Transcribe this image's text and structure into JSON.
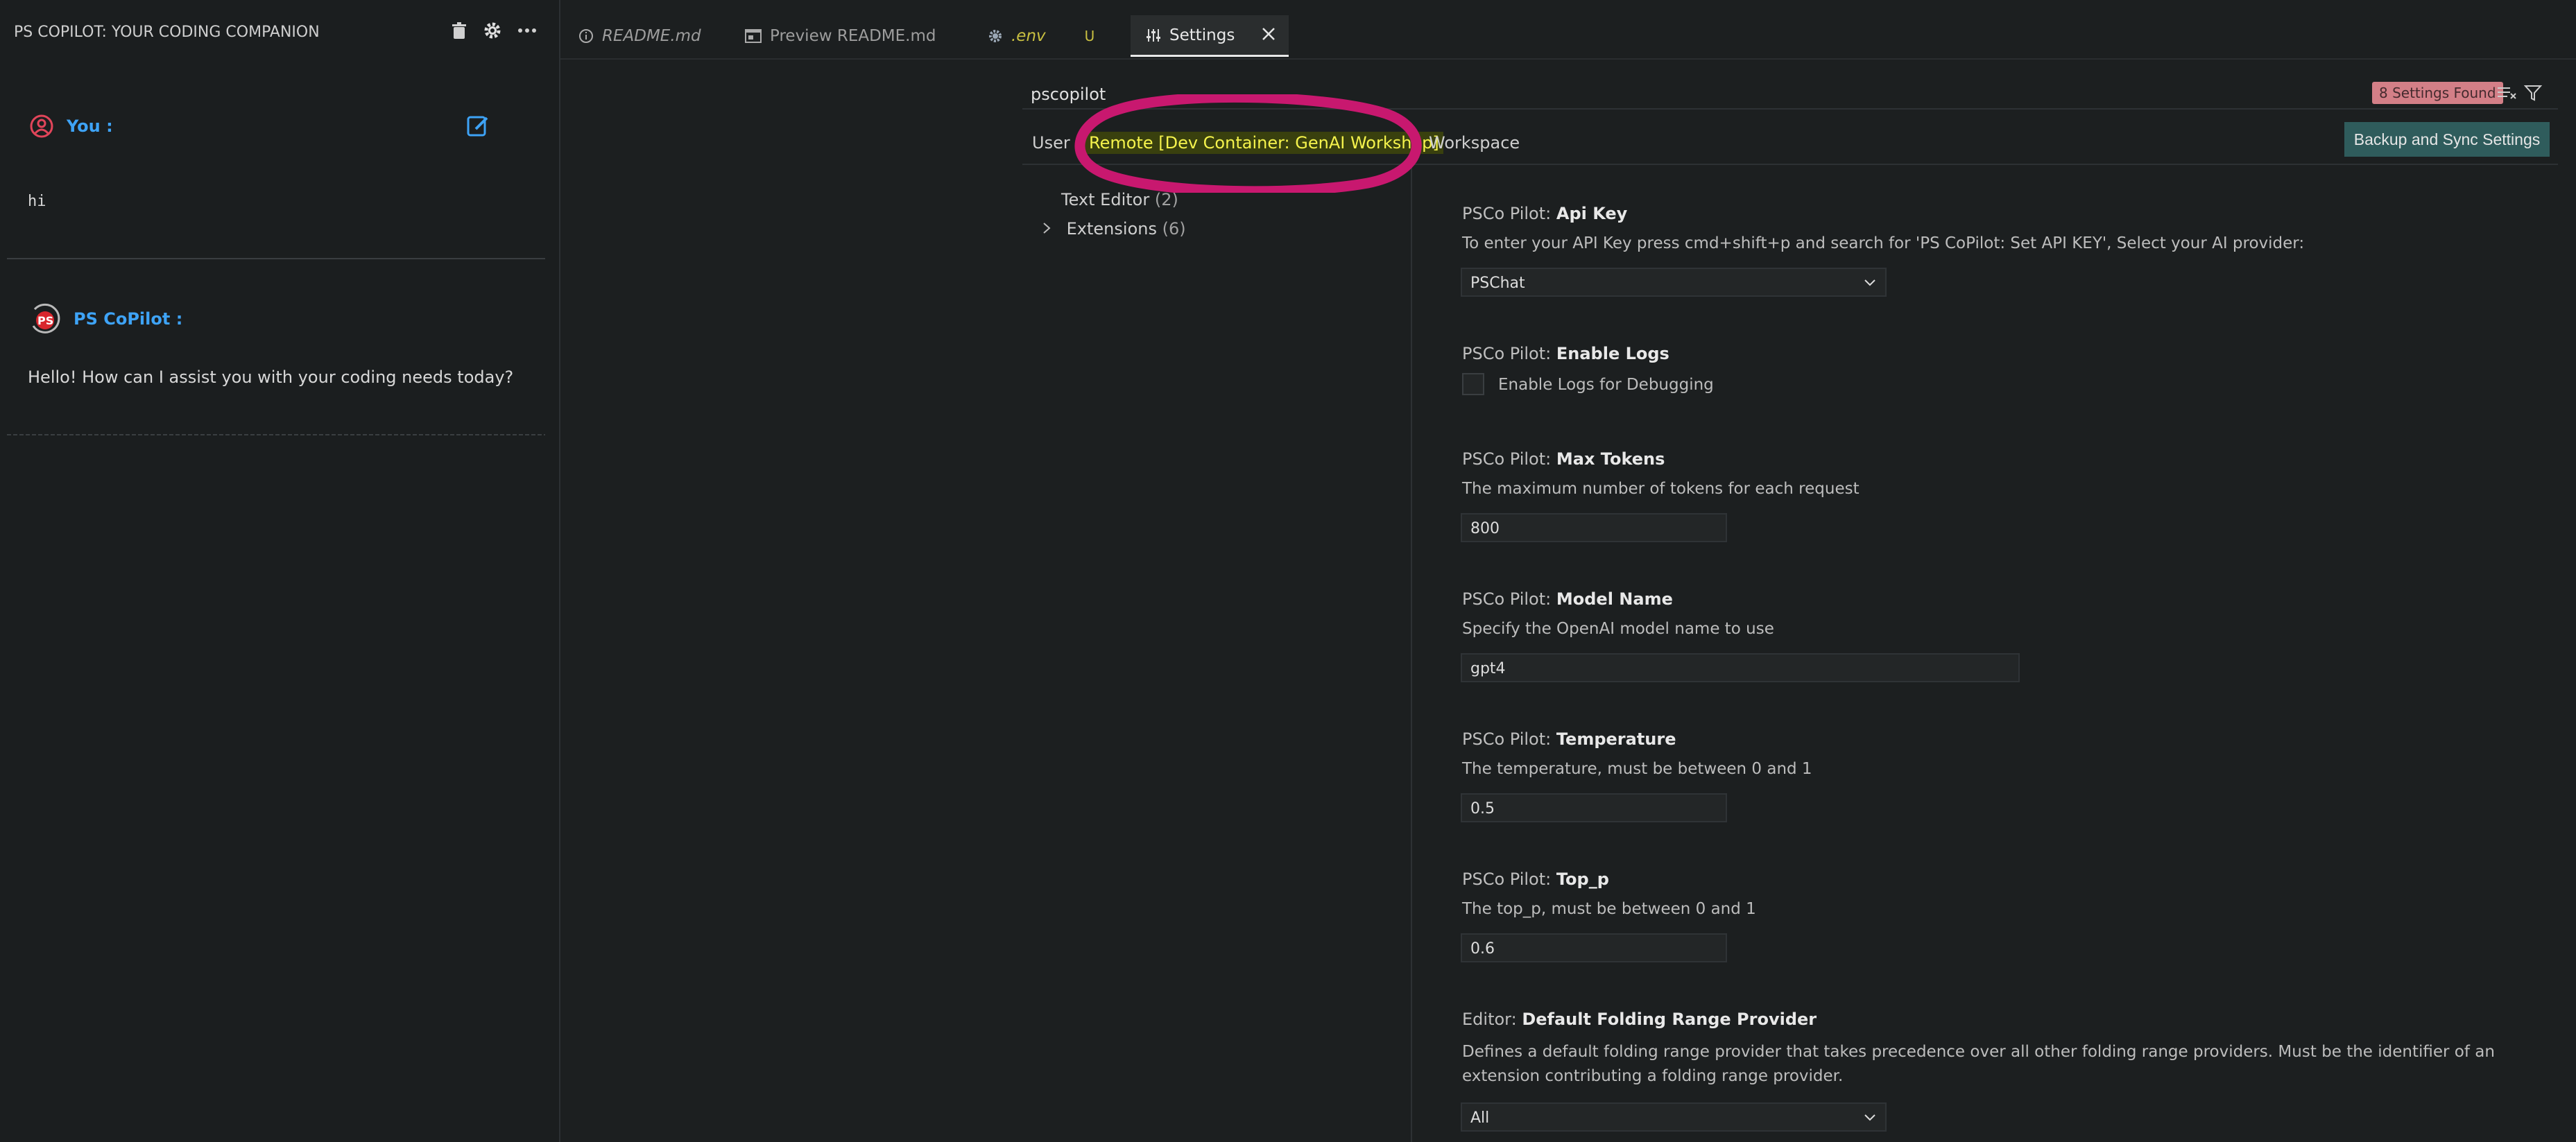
{
  "chat_panel": {
    "title": "PS COPILOT: YOUR CODING COMPANION",
    "messages": [
      {
        "sender": "You :",
        "text": "hi"
      },
      {
        "sender": "PS CoPilot :",
        "text": "Hello! How can I assist you with your coding needs today?"
      }
    ],
    "bot_avatar_label": "PS"
  },
  "tabs": [
    {
      "label": "README.md",
      "icon": "info-icon"
    },
    {
      "label": "Preview README.md",
      "icon": "preview-icon"
    },
    {
      "label": ".env",
      "icon": "gear-icon",
      "status": "U"
    },
    {
      "label": "Settings",
      "icon": "settings-icon",
      "active": true
    }
  ],
  "settings": {
    "search_value": "pscopilot",
    "found_badge": "8 Settings Found",
    "scopes": [
      "User",
      "Remote [Dev Container: GenAI Workshop]",
      "Workspace"
    ],
    "sync_button": "Backup and Sync Settings",
    "toc": [
      {
        "label": "Text Editor",
        "count": "(2)"
      },
      {
        "label": "Extensions",
        "count": "(6)"
      }
    ],
    "items": [
      {
        "prefix": "PSCo Pilot: ",
        "name": "Api Key",
        "desc": "To enter your API Key press cmd+shift+p and search for 'PS CoPilot: Set API KEY', Select your AI provider:",
        "value": "PSChat"
      },
      {
        "prefix": "PSCo Pilot: ",
        "name": "Enable Logs",
        "checkbox_label": "Enable Logs for Debugging"
      },
      {
        "prefix": "PSCo Pilot: ",
        "name": "Max Tokens",
        "desc": "The maximum number of tokens for each request",
        "value": "800"
      },
      {
        "prefix": "PSCo Pilot: ",
        "name": "Model Name",
        "desc": "Specify the OpenAI model name to use",
        "value": "gpt4"
      },
      {
        "prefix": "PSCo Pilot: ",
        "name": "Temperature",
        "desc": "The temperature, must be between 0 and 1",
        "value": "0.5"
      },
      {
        "prefix": "PSCo Pilot: ",
        "name": "Top_p",
        "desc": "The top_p, must be between 0 and 1",
        "value": "0.6"
      },
      {
        "prefix": "Editor: ",
        "name": "Default Folding Range Provider",
        "desc": "Defines a default folding range provider that takes precedence over all other folding range providers. Must be the identifier of an extension contributing a folding range provider.",
        "value": "All"
      }
    ]
  },
  "colors": {
    "accent_blue": "#3ea3f6",
    "annotation_magenta": "#c8186f",
    "highlight_yellow": "#f5f34c",
    "badge_pink": "#d37f87",
    "sync_teal": "#2f5c5c"
  }
}
